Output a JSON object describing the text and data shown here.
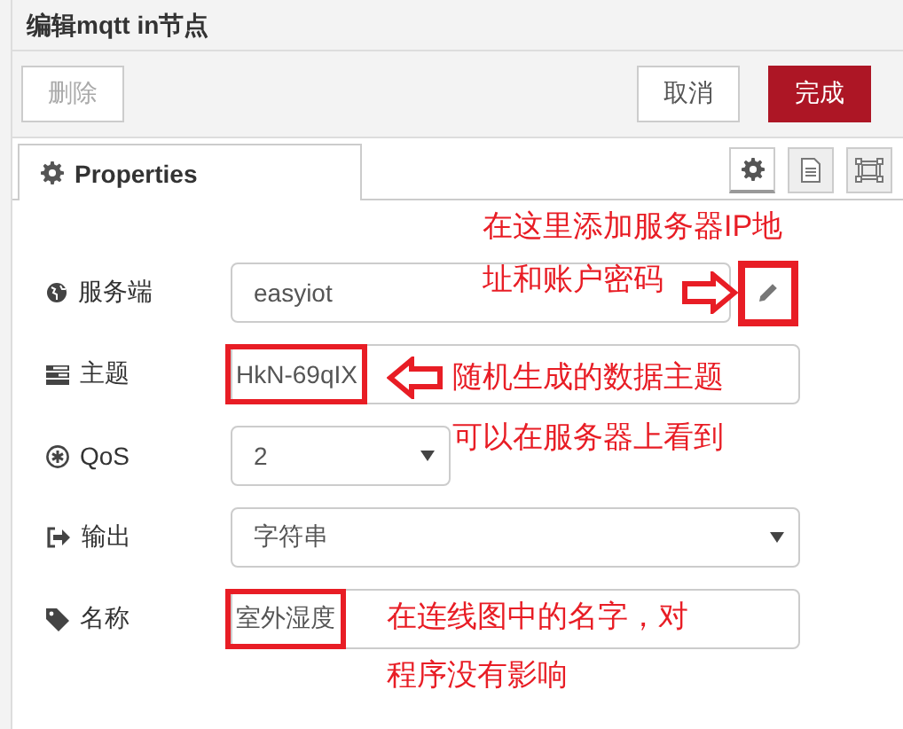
{
  "window": {
    "title": "编辑mqtt in节点"
  },
  "toolbar": {
    "buttons": [
      {
        "label": "删除",
        "kind": "plain",
        "disabled": true
      },
      {
        "label": "取消",
        "kind": "plain",
        "disabled": false
      },
      {
        "label": "完成",
        "kind": "primary",
        "disabled": false
      }
    ]
  },
  "tabs": [
    {
      "label": "Properties",
      "selected": true
    }
  ],
  "panel_buttons": [
    {
      "selected": true
    },
    {
      "selected": false
    },
    {
      "selected": false
    }
  ],
  "fields": [
    {
      "label": "服务端",
      "kind": "config",
      "value": "easyiot",
      "highlighted": true
    },
    {
      "label": "主题",
      "kind": "input",
      "value": "HkN-69qIX",
      "highlighted": true
    },
    {
      "label": "QoS",
      "kind": "select-short",
      "value": "2",
      "highlighted": false
    },
    {
      "label": "输出",
      "kind": "select",
      "value": "字符串",
      "highlighted": false
    },
    {
      "label": "名称",
      "kind": "input",
      "value": "室外湿度",
      "highlighted": true
    }
  ],
  "annotations": [
    {
      "text": "在这里添加服务器IP地"
    },
    {
      "text": "址和账户密码"
    },
    {
      "text": "随机生成的数据主题"
    },
    {
      "text": "可以在服务器上看到"
    },
    {
      "text": "在连线图中的名字，对"
    },
    {
      "text": "程序没有影响"
    }
  ]
}
